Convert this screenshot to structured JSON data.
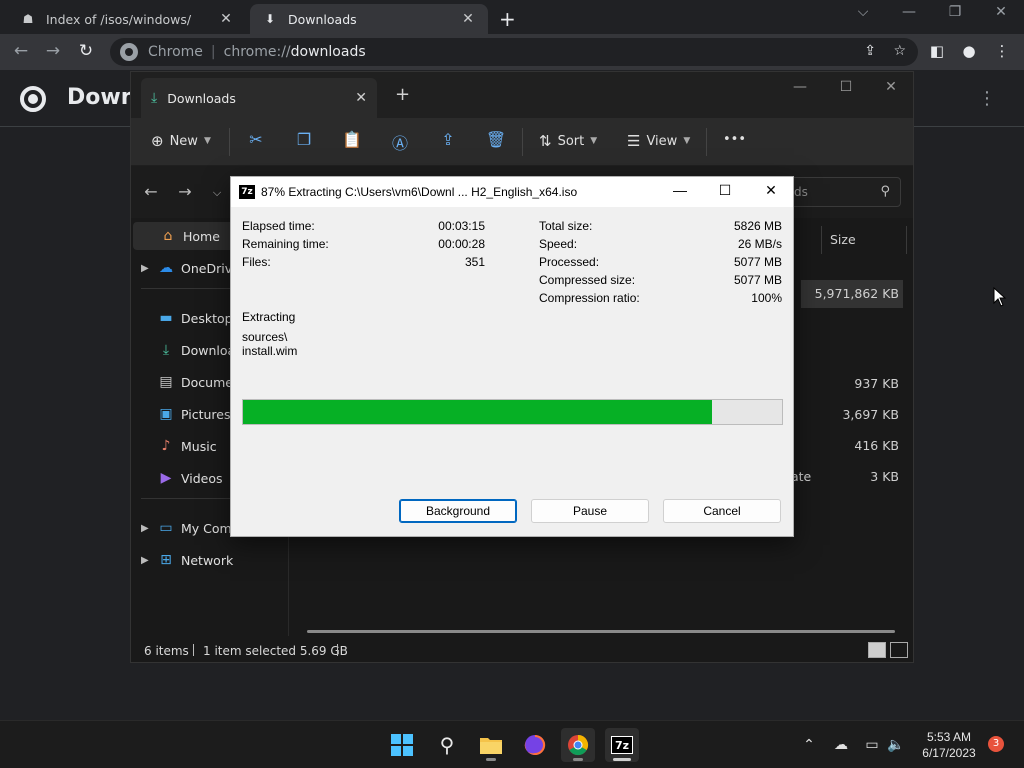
{
  "chrome": {
    "tabs": [
      {
        "label": "Index of /isos/windows/",
        "icon": "page-icon"
      },
      {
        "label": "Downloads",
        "icon": "download-icon"
      }
    ],
    "omnibox": {
      "site": "Chrome",
      "scheme": "chrome://",
      "path": "downloads"
    },
    "page_title": "Downl"
  },
  "explorer": {
    "tab_label": "Downloads",
    "commands": {
      "new": "New",
      "sort": "Sort",
      "view": "View",
      "more": "•••"
    },
    "search_placeholder": "ds",
    "sidebar": {
      "home": "Home",
      "onedrive": "OneDrive",
      "desktop": "Desktop",
      "downloads": "Downloa",
      "documents": "Docume",
      "pictures": "Pictures",
      "music": "Music",
      "videos": "Videos",
      "mycomputer": "My Computer",
      "network": "Network"
    },
    "column_size": "Size",
    "rows": {
      "r1": "5,971,862 KB",
      "r2": "937 KB",
      "r3": "3,697 KB",
      "r4": "416 KB",
      "r5_text": "ate",
      "r5": "3 KB"
    },
    "status": {
      "items": "6 items",
      "selected": "1 item selected  5.69 GB"
    }
  },
  "sevenzip": {
    "logo": "7z",
    "title": "87% Extracting C:\\Users\\vm6\\Downl ... H2_English_x64.iso",
    "progress_fraction": 0.87,
    "left": [
      {
        "label": "Elapsed time:",
        "value": "00:03:15"
      },
      {
        "label": "Remaining time:",
        "value": "00:00:28"
      },
      {
        "label": "Files:",
        "value": "351"
      }
    ],
    "right": [
      {
        "label": "Total size:",
        "value": "5826 MB"
      },
      {
        "label": "Speed:",
        "value": "26 MB/s"
      },
      {
        "label": "Processed:",
        "value": "5077 MB"
      },
      {
        "label": "Compressed size:",
        "value": "5077 MB"
      },
      {
        "label": "Compression ratio:",
        "value": "100%"
      }
    ],
    "action": "Extracting",
    "path_line1": "sources\\",
    "path_line2": "install.wim",
    "buttons": {
      "background": "Background",
      "pause": "Pause",
      "cancel": "Cancel"
    }
  },
  "taskbar": {
    "time": "5:53 AM",
    "date": "6/17/2023",
    "notifications": "3"
  }
}
